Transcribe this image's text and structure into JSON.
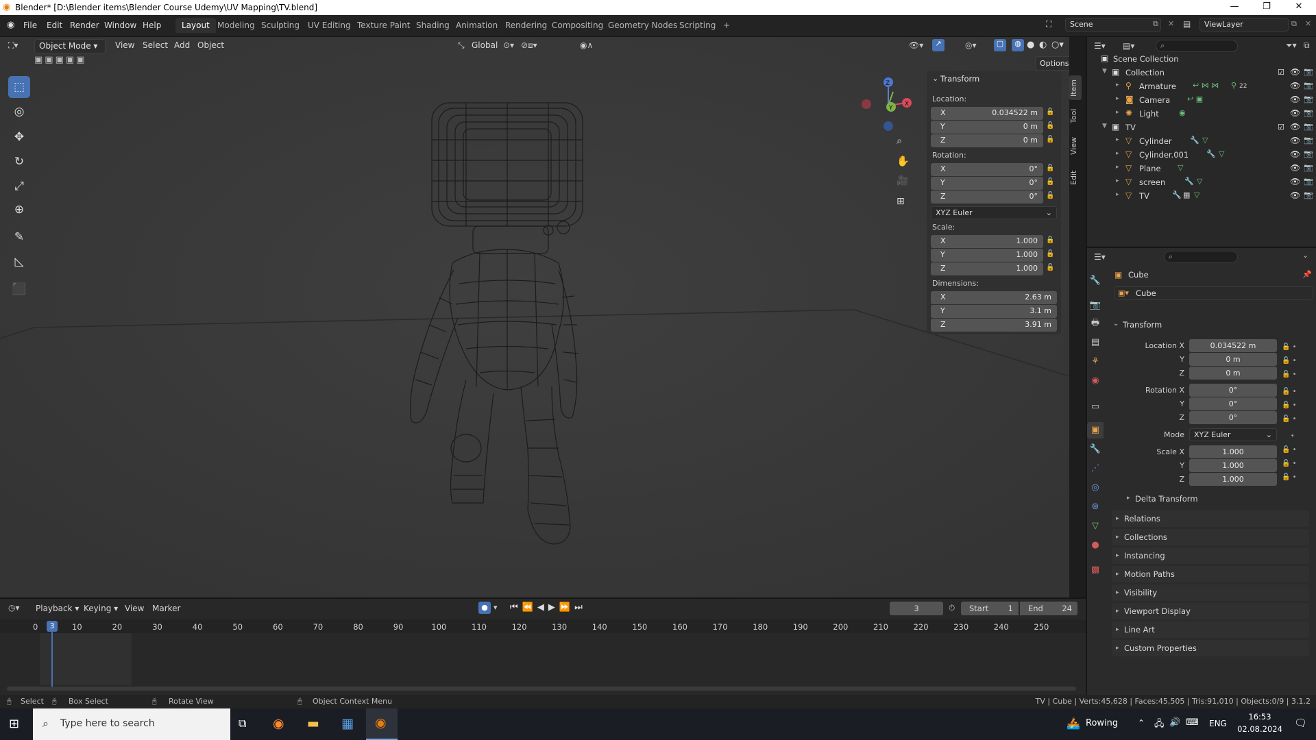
{
  "window": {
    "title": "Blender* [D:\\Blender items\\Blender Course Udemy\\UV Mapping\\TV.blend]",
    "minimize": "—",
    "maximize": "❐",
    "close": "✕"
  },
  "menu": [
    "File",
    "Edit",
    "Render",
    "Window",
    "Help"
  ],
  "workspaces": [
    "Layout",
    "Modeling",
    "Sculpting",
    "UV Editing",
    "Texture Paint",
    "Shading",
    "Animation",
    "Rendering",
    "Compositing",
    "Geometry Nodes",
    "Scripting",
    "+"
  ],
  "active_workspace": "Layout",
  "scene": {
    "name": "Scene",
    "view_layer": "ViewLayer"
  },
  "viewport_header": {
    "mode": "Object Mode",
    "menus": [
      "View",
      "Select",
      "Add",
      "Object"
    ],
    "transform_orientation": "Global",
    "options": "Options"
  },
  "toolbar_tools": [
    {
      "name": "select-box-tool",
      "icon": "⬚",
      "active": true
    },
    {
      "name": "cursor-tool",
      "icon": "◎"
    },
    {
      "name": "move-tool",
      "icon": "✥"
    },
    {
      "name": "rotate-tool",
      "icon": "↻"
    },
    {
      "name": "scale-tool",
      "icon": "⤢"
    },
    {
      "name": "transform-tool",
      "icon": "⊕"
    },
    {
      "name": "annotate-tool",
      "icon": "✎"
    },
    {
      "name": "measure-tool",
      "icon": "📐"
    },
    {
      "name": "add-cube-tool",
      "icon": "⬛"
    }
  ],
  "n_panel": {
    "header": "Transform",
    "location_label": "Location:",
    "location": [
      {
        "axis": "X",
        "value": "0.034522 m"
      },
      {
        "axis": "Y",
        "value": "0 m"
      },
      {
        "axis": "Z",
        "value": "0 m"
      }
    ],
    "rotation_label": "Rotation:",
    "rotation": [
      {
        "axis": "X",
        "value": "0°"
      },
      {
        "axis": "Y",
        "value": "0°"
      },
      {
        "axis": "Z",
        "value": "0°"
      }
    ],
    "rotation_mode": "XYZ Euler",
    "scale_label": "Scale:",
    "scale": [
      {
        "axis": "X",
        "value": "1.000"
      },
      {
        "axis": "Y",
        "value": "1.000"
      },
      {
        "axis": "Z",
        "value": "1.000"
      }
    ],
    "dimensions_label": "Dimensions:",
    "dimensions": [
      {
        "axis": "X",
        "value": "2.63 m"
      },
      {
        "axis": "Y",
        "value": "3.1 m"
      },
      {
        "axis": "Z",
        "value": "3.91 m"
      }
    ],
    "tabs": [
      "Item",
      "Tool",
      "View",
      "Edit"
    ]
  },
  "outliner": {
    "rows": [
      {
        "name": "Scene Collection",
        "level": 0,
        "icon": "▣",
        "arrow": ""
      },
      {
        "name": "Collection",
        "level": 1,
        "icon": "▣",
        "arrow": "▼"
      },
      {
        "name": "Armature",
        "level": 2,
        "icon": "⚲",
        "arrow": "▸",
        "extra": "22"
      },
      {
        "name": "Camera",
        "level": 2,
        "icon": "📷",
        "arrow": "▸"
      },
      {
        "name": "Light",
        "level": 2,
        "icon": "💡",
        "arrow": "▸"
      },
      {
        "name": "TV",
        "level": 1,
        "icon": "▣",
        "arrow": "▼"
      },
      {
        "name": "Cylinder",
        "level": 2,
        "icon": "▽",
        "arrow": "▸"
      },
      {
        "name": "Cylinder.001",
        "level": 2,
        "icon": "▽",
        "arrow": "▸"
      },
      {
        "name": "Plane",
        "level": 2,
        "icon": "▽",
        "arrow": "▸"
      },
      {
        "name": "screen",
        "level": 2,
        "icon": "▽",
        "arrow": "▸"
      },
      {
        "name": "TV",
        "level": 2,
        "icon": "▽",
        "arrow": "▸"
      }
    ]
  },
  "properties": {
    "object_name": "Cube",
    "data_name": "Cube",
    "section": "Transform",
    "fields": [
      {
        "label": "Location X",
        "value": "0.034522 m"
      },
      {
        "label": "Y",
        "value": "0 m"
      },
      {
        "label": "Z",
        "value": "0 m"
      },
      {
        "label": "Rotation X",
        "value": "0°"
      },
      {
        "label": "Y",
        "value": "0°"
      },
      {
        "label": "Z",
        "value": "0°"
      },
      {
        "label": "Mode",
        "value": "XYZ Euler"
      },
      {
        "label": "Scale X",
        "value": "1.000"
      },
      {
        "label": "Y",
        "value": "1.000"
      },
      {
        "label": "Z",
        "value": "1.000"
      }
    ],
    "delta": "Delta Transform",
    "subpanels": [
      "Relations",
      "Collections",
      "Instancing",
      "Motion Paths",
      "Visibility",
      "Viewport Display",
      "Line Art",
      "Custom Properties"
    ]
  },
  "timeline": {
    "menus": [
      "Playback",
      "Keying",
      "View",
      "Marker"
    ],
    "current_frame": "3",
    "start_label": "Start",
    "start": "1",
    "end_label": "End",
    "end": "24",
    "ticks": [
      "0",
      "10",
      "20",
      "30",
      "40",
      "50",
      "60",
      "70",
      "80",
      "90",
      "100",
      "110",
      "120",
      "130",
      "140",
      "150",
      "160",
      "170",
      "180",
      "190",
      "200",
      "210",
      "220",
      "230",
      "240",
      "250"
    ]
  },
  "statusbar": {
    "select": "Select",
    "box_select": "Box Select",
    "rotate_view": "Rotate View",
    "context_menu": "Object Context Menu",
    "stats": "TV | Cube | Verts:45,628 | Faces:45,505 | Tris:91,010 | Objects:0/9 | 3.1.2"
  },
  "taskbar": {
    "search_placeholder": "Type here to search",
    "weather": "Rowing",
    "language": "ENG",
    "time": "16:53",
    "date": "02.08.2024"
  }
}
